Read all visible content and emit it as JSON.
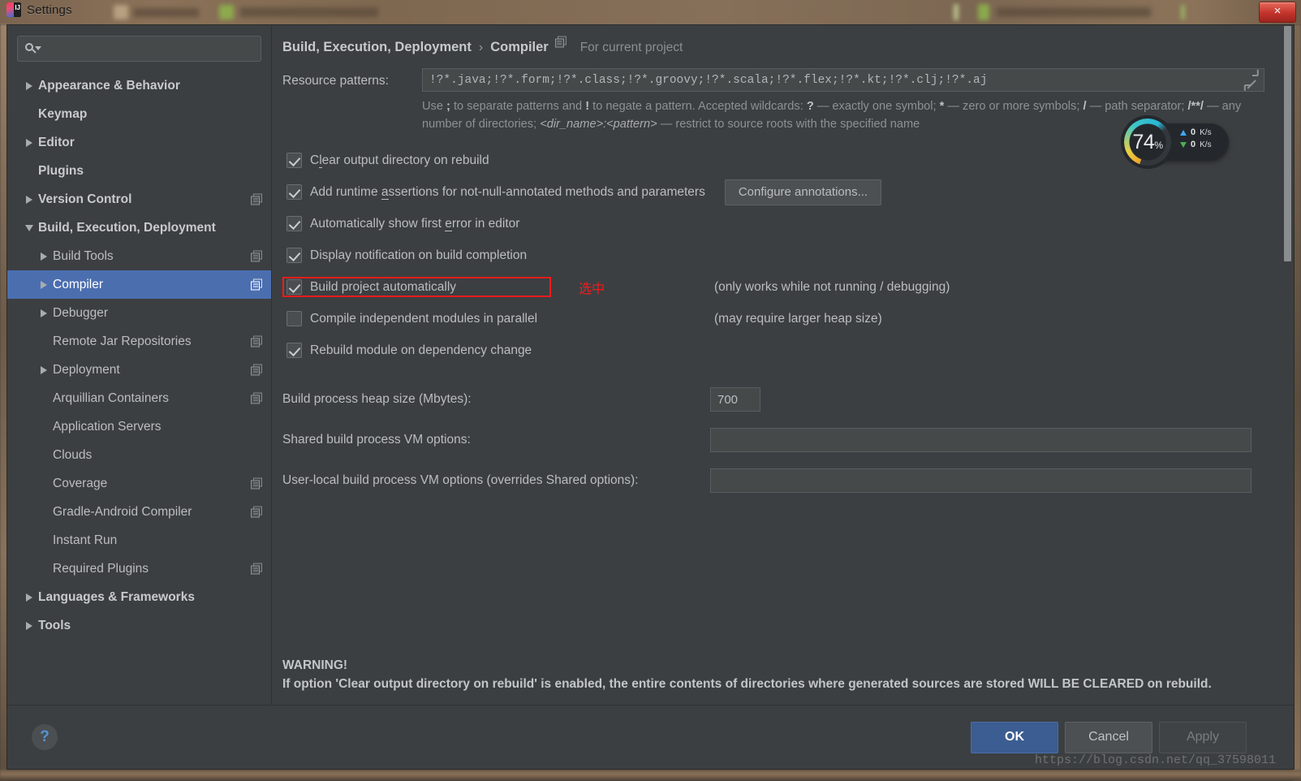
{
  "window": {
    "title": "Settings",
    "close_label": "×",
    "app_icon": "intellij-idea-logo"
  },
  "search": {
    "placeholder": "",
    "value": "",
    "icon": "search-icon"
  },
  "sidebar": {
    "items": [
      {
        "label": "Appearance & Behavior",
        "level": 0,
        "arrow": "right",
        "bold": true,
        "mod_icon": false,
        "selected": false
      },
      {
        "label": "Keymap",
        "level": 0,
        "arrow": "none",
        "bold": true,
        "mod_icon": false,
        "selected": false
      },
      {
        "label": "Editor",
        "level": 0,
        "arrow": "right",
        "bold": true,
        "mod_icon": false,
        "selected": false
      },
      {
        "label": "Plugins",
        "level": 0,
        "arrow": "none",
        "bold": true,
        "mod_icon": false,
        "selected": false
      },
      {
        "label": "Version Control",
        "level": 0,
        "arrow": "right",
        "bold": true,
        "mod_icon": true,
        "selected": false
      },
      {
        "label": "Build, Execution, Deployment",
        "level": 0,
        "arrow": "down",
        "bold": true,
        "mod_icon": false,
        "selected": false
      },
      {
        "label": "Build Tools",
        "level": 1,
        "arrow": "right",
        "bold": false,
        "mod_icon": true,
        "selected": false
      },
      {
        "label": "Compiler",
        "level": 1,
        "arrow": "right",
        "bold": false,
        "mod_icon": true,
        "selected": true
      },
      {
        "label": "Debugger",
        "level": 1,
        "arrow": "right",
        "bold": false,
        "mod_icon": false,
        "selected": false
      },
      {
        "label": "Remote Jar Repositories",
        "level": 1,
        "arrow": "none",
        "bold": false,
        "mod_icon": true,
        "selected": false
      },
      {
        "label": "Deployment",
        "level": 1,
        "arrow": "right",
        "bold": false,
        "mod_icon": true,
        "selected": false
      },
      {
        "label": "Arquillian Containers",
        "level": 1,
        "arrow": "none",
        "bold": false,
        "mod_icon": true,
        "selected": false
      },
      {
        "label": "Application Servers",
        "level": 1,
        "arrow": "none",
        "bold": false,
        "mod_icon": false,
        "selected": false
      },
      {
        "label": "Clouds",
        "level": 1,
        "arrow": "none",
        "bold": false,
        "mod_icon": false,
        "selected": false
      },
      {
        "label": "Coverage",
        "level": 1,
        "arrow": "none",
        "bold": false,
        "mod_icon": true,
        "selected": false
      },
      {
        "label": "Gradle-Android Compiler",
        "level": 1,
        "arrow": "none",
        "bold": false,
        "mod_icon": true,
        "selected": false
      },
      {
        "label": "Instant Run",
        "level": 1,
        "arrow": "none",
        "bold": false,
        "mod_icon": false,
        "selected": false
      },
      {
        "label": "Required Plugins",
        "level": 1,
        "arrow": "none",
        "bold": false,
        "mod_icon": true,
        "selected": false
      },
      {
        "label": "Languages & Frameworks",
        "level": 0,
        "arrow": "right",
        "bold": true,
        "mod_icon": false,
        "selected": false
      },
      {
        "label": "Tools",
        "level": 0,
        "arrow": "right",
        "bold": true,
        "mod_icon": false,
        "selected": false
      }
    ]
  },
  "breadcrumb": {
    "parent": "Build, Execution, Deployment",
    "separator": "›",
    "current": "Compiler",
    "scope_label": "For current project",
    "scope_icon": "module-scope-icon"
  },
  "form": {
    "resource_patterns_label": "Resource patterns:",
    "resource_patterns_value": "!?*.java;!?*.form;!?*.class;!?*.groovy;!?*.scala;!?*.flex;!?*.kt;!?*.clj;!?*.aj",
    "resource_patterns_placeholder": "",
    "expand_icon": "expand-icon",
    "hint_line1_a": "Use ",
    "hint_semicolon": ";",
    "hint_line1_b": " to separate patterns and ",
    "hint_bang": "!",
    "hint_line1_c": " to negate a pattern. Accepted wildcards: ",
    "hint_q": "?",
    "hint_line1_d": " — exactly one symbol; ",
    "hint_star": "*",
    "hint_line1_e": " — zero or more symbols; ",
    "hint_slash": "/",
    "hint_line2_a": " — path separator; ",
    "hint_dblstar": "/**/",
    "hint_line2_b": " — any number of directories; ",
    "hint_dirname": "<dir_name>:<pattern>",
    "hint_line2_c": " — restrict to source roots with the specified name"
  },
  "checkboxes": [
    {
      "label_pre": "C",
      "label_underlined": "l",
      "label_post": "ear output directory on rebuild",
      "checked": true,
      "highlight": false,
      "note": "",
      "button": "",
      "annotation": ""
    },
    {
      "label_pre": "Add runtime ",
      "label_underlined": "a",
      "label_post": "ssertions for not-null-annotated methods and parameters",
      "checked": true,
      "highlight": false,
      "note": "",
      "button": "Configure annotations...",
      "annotation": ""
    },
    {
      "label_pre": "Automatically show first ",
      "label_underlined": "e",
      "label_post": "rror in editor",
      "checked": true,
      "highlight": false,
      "note": "",
      "button": "",
      "annotation": ""
    },
    {
      "label_pre": "Display notification on build completion",
      "label_underlined": "",
      "label_post": "",
      "checked": true,
      "highlight": false,
      "note": "",
      "button": "",
      "annotation": ""
    },
    {
      "label_pre": "Build project automatically",
      "label_underlined": "",
      "label_post": "",
      "checked": true,
      "highlight": true,
      "note": "(only works while not running / debugging)",
      "button": "",
      "annotation": "选中"
    },
    {
      "label_pre": "Compile independent modules in parallel",
      "label_underlined": "",
      "label_post": "",
      "checked": false,
      "highlight": false,
      "note": "(may require larger heap size)",
      "button": "",
      "annotation": ""
    },
    {
      "label_pre": "Rebuild module on dependency change",
      "label_underlined": "",
      "label_post": "",
      "checked": true,
      "highlight": false,
      "note": "",
      "button": "",
      "annotation": ""
    }
  ],
  "fields": {
    "heap_label": "Build process heap size (Mbytes):",
    "heap_value": "700",
    "shared_vm_label": "Shared build process VM options:",
    "shared_vm_value": "",
    "shared_vm_placeholder": "",
    "user_vm_label": "User-local build process VM options (overrides Shared options):",
    "user_vm_value": "",
    "user_vm_placeholder": ""
  },
  "warning": {
    "title": "WARNING!",
    "body": "If option 'Clear output directory on rebuild' is enabled, the entire contents of directories where generated sources are stored WILL BE CLEARED on rebuild."
  },
  "footer": {
    "help_label": "?",
    "ok_label": "OK",
    "cancel_label": "Cancel",
    "apply_label": "Apply",
    "watermark": "https://blog.csdn.net/qq_37598011"
  },
  "net_widget": {
    "percent": "74",
    "percent_unit": "%",
    "upload_value": "0",
    "upload_unit": "K/s",
    "download_value": "0",
    "download_unit": "K/s"
  },
  "colors": {
    "accent": "#4b6eaf",
    "highlight": "#f01c1c",
    "panel": "#3c3f41",
    "field": "#45494a",
    "text": "#bbbdbf"
  }
}
